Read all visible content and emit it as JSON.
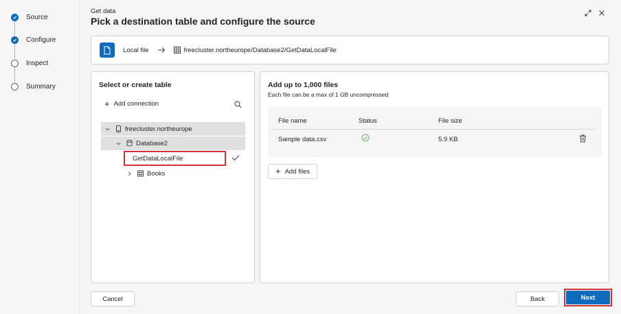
{
  "stepper": {
    "steps": [
      {
        "label": "Source",
        "done": true
      },
      {
        "label": "Configure",
        "done": true
      },
      {
        "label": "Inspect",
        "done": false
      },
      {
        "label": "Summary",
        "done": false
      }
    ]
  },
  "header": {
    "subtitle": "Get data",
    "title": "Pick a destination table and configure the source"
  },
  "source_bar": {
    "source_label": "Local file",
    "destination_path": "freecluster.northeurope/Database2/GetDataLocalFile"
  },
  "left_panel": {
    "heading": "Select or create table",
    "add_connection_label": "Add connection",
    "tree": {
      "cluster": "freecluster.northeurope",
      "database": "Database2",
      "selected_table": "GetDataLocalFile",
      "other_table": "Books"
    }
  },
  "right_panel": {
    "heading": "Add up to 1,000 files",
    "subheading": "Each file can be a max of 1 GB uncompressed",
    "columns": [
      "File name",
      "Status",
      "File size"
    ],
    "rows": [
      {
        "file_name": "Sample data.csv",
        "status": "success",
        "file_size": "5.9 KB"
      }
    ],
    "add_files_label": "Add files"
  },
  "footer": {
    "cancel_label": "Cancel",
    "back_label": "Back",
    "next_label": "Next"
  },
  "colors": {
    "accent": "#0f6cbd",
    "highlight_border": "#d13438",
    "success": "#107c10"
  }
}
